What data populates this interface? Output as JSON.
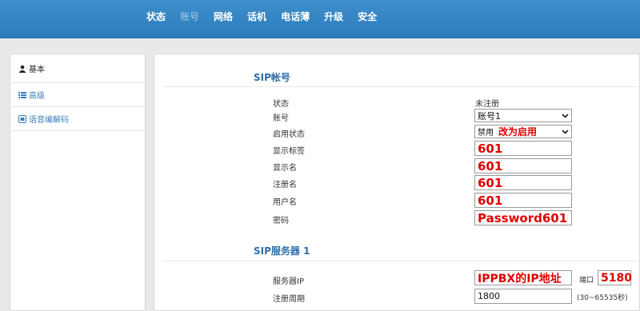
{
  "nav": {
    "items": [
      "状态",
      "账号",
      "网络",
      "话机",
      "电话薄",
      "升级",
      "安全"
    ],
    "active": "账号"
  },
  "sidebar": {
    "items": [
      {
        "label": "基本",
        "icon": "user-icon"
      },
      {
        "label": "高级",
        "icon": "list-icon"
      },
      {
        "label": "语音编解码",
        "icon": "codec-icon"
      }
    ]
  },
  "sip_account": {
    "title": "SIP帐号",
    "status_label": "状态",
    "status_value": "未注册",
    "account_label": "账号",
    "account_value": "账号1",
    "enable_label": "启用状态",
    "enable_value": "禁用",
    "enable_annotation": "改为启用",
    "display_tag_label": "显示标签",
    "display_tag_value": "601",
    "display_name_label": "显示名",
    "display_name_value": "601",
    "register_name_label": "注册名",
    "register_name_value": "601",
    "username_label": "用户名",
    "username_value": "601",
    "password_label": "密码",
    "password_value": "Password601"
  },
  "sip_server": {
    "title": "SIP服务器 1",
    "server_ip_label": "服务器IP",
    "server_ip_value": "IPPBX的IP地址",
    "port_label": "端口",
    "port_value": "5180",
    "register_period_label": "注册周期",
    "register_period_value": "1800",
    "register_period_hint": "(30~65535秒)"
  },
  "colors": {
    "accent": "#2d7cbd",
    "annotation": "#e00000"
  }
}
